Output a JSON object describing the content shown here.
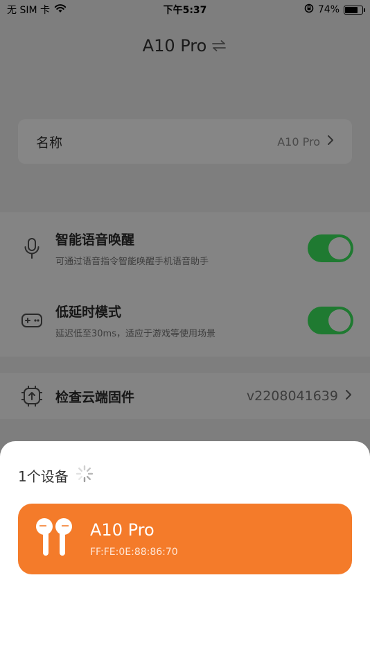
{
  "status_bar": {
    "carrier": "无 SIM 卡",
    "time": "下午5:37",
    "battery_percent": "74%",
    "battery_level": 0.74
  },
  "header": {
    "title": "A10 Pro"
  },
  "name_card": {
    "label": "名称",
    "value": "A10 Pro"
  },
  "features": [
    {
      "title": "智能语音唤醒",
      "description": "可通过语音指令智能唤醒手机语音助手",
      "enabled": true
    },
    {
      "title": "低延时模式",
      "description": "延迟低至30ms，适应于游戏等使用场景",
      "enabled": true
    }
  ],
  "firmware": {
    "title": "检查云端固件",
    "version": "v2208041639"
  },
  "sheet": {
    "title": "1个设备",
    "devices": [
      {
        "name": "A10 Pro",
        "mac": "FF:FE:0E:88:86:70"
      }
    ]
  },
  "colors": {
    "accent": "#f47b2a",
    "toggle_on": "#1f7a31"
  },
  "icons": {
    "mic": "microphone-icon",
    "game": "gamepad-icon",
    "chip": "chip-upload-icon",
    "swap": "swap-icon",
    "earbuds": "earbuds-icon"
  }
}
